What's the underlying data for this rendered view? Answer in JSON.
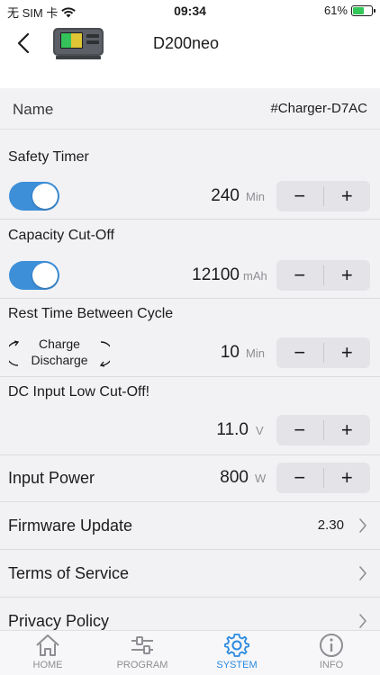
{
  "status_bar": {
    "carrier": "无 SIM 卡",
    "time": "09:34",
    "battery_percent": "61%",
    "battery_level": 0.61
  },
  "nav": {
    "title": "D200neo"
  },
  "device_name": {
    "label": "Name",
    "value": "#Charger-D7AC"
  },
  "safety_timer": {
    "title": "Safety Timer",
    "enabled": true,
    "value": "240",
    "unit": "Min"
  },
  "capacity_cutoff": {
    "title": "Capacity Cut-Off",
    "enabled": true,
    "value": "12100",
    "unit": "mAh"
  },
  "rest_time": {
    "title": "Rest Time Between Cycle",
    "cycle_charge": "Charge",
    "cycle_discharge": "Discharge",
    "value": "10",
    "unit": "Min"
  },
  "dc_input": {
    "title": "DC Input Low Cut-Off!",
    "value": "11.0",
    "unit": "V"
  },
  "input_power": {
    "label": "Input Power",
    "value": "800",
    "unit": "W"
  },
  "stepper": {
    "minus": "−",
    "plus": "+"
  },
  "firmware": {
    "label": "Firmware Update",
    "value": "2.30"
  },
  "terms": {
    "label": "Terms of Service"
  },
  "privacy": {
    "label": "Privacy Policy"
  },
  "tabs": [
    {
      "label": "HOME",
      "icon": "home-icon"
    },
    {
      "label": "PROGRAM",
      "icon": "sliders-icon"
    },
    {
      "label": "SYSTEM",
      "icon": "gear-icon"
    },
    {
      "label": "INFO",
      "icon": "info-icon"
    }
  ],
  "colors": {
    "accent": "#2b8ae0",
    "toggle_on": "#3d8fd8",
    "background": "#f2f2f4"
  }
}
